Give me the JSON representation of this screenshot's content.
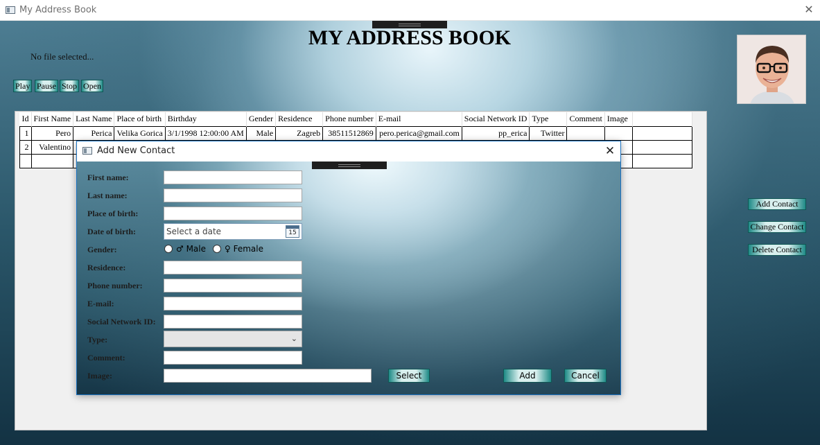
{
  "window": {
    "title": "My Address Book",
    "close_glyph": "✕"
  },
  "header": {
    "title": "MY ADDRESS BOOK",
    "file_status": "No file selected..."
  },
  "media": {
    "play": "Play",
    "pause": "Pause",
    "stop": "Stop",
    "open": "Open"
  },
  "sidebar": {
    "add": "Add Contact",
    "change": "Change Contact",
    "delete": "Delete Contact"
  },
  "table": {
    "columns": [
      "Id",
      "First Name",
      "Last Name",
      "Place of birth",
      "Birthday",
      "Gender",
      "Residence",
      "Phone number",
      "E-mail",
      "Social Network ID",
      "Type",
      "Comment",
      "Image"
    ],
    "rows": [
      [
        "1",
        "Pero",
        "Perica",
        "Velika Gorica",
        "3/1/1998 12:00:00 AM",
        "Male",
        "Zagreb",
        "38511512869",
        "pero.perica@gmail.com",
        "pp_erica",
        "Twitter",
        "",
        ""
      ],
      [
        "2",
        "Valentino",
        "",
        "",
        "",
        "",
        "",
        "",
        "",
        "",
        "",
        "",
        ""
      ]
    ]
  },
  "dialog": {
    "title": "Add New Contact",
    "close_glyph": "✕",
    "labels": {
      "first_name": "First name:",
      "last_name": "Last name:",
      "place_of_birth": "Place of birth:",
      "date_of_birth": "Date of birth:",
      "gender": "Gender:",
      "residence": "Residence:",
      "phone": "Phone number:",
      "email": "E-mail:",
      "social": "Social Network ID:",
      "type": "Type:",
      "comment": "Comment:",
      "image": "Image:"
    },
    "date_placeholder": "Select a date",
    "calendar_day": "15",
    "gender_options": {
      "male": "♂ Male",
      "female": "♀ Female"
    },
    "type_value": "",
    "buttons": {
      "select": "Select",
      "add": "Add",
      "cancel": "Cancel"
    }
  },
  "icons": {
    "app": "window-icon",
    "close": "close-icon",
    "calendar": "calendar-icon",
    "dropdown": "chevron-down-icon"
  },
  "colors": {
    "accent_button": "#1e8a86",
    "dialog_border": "#1b72c1"
  }
}
